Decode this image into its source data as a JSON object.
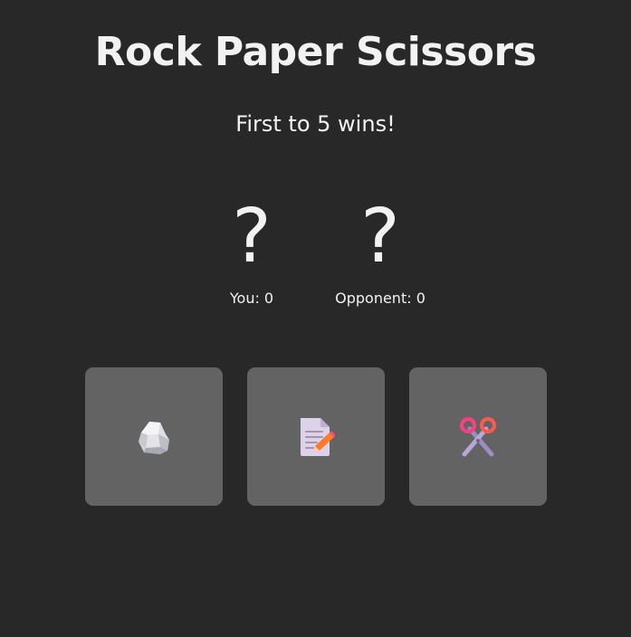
{
  "header": {
    "title": "Rock Paper Scissors",
    "subtitle": "First to 5 wins!"
  },
  "scoreboard": {
    "you": {
      "choice": "?",
      "label": "You: 0",
      "score": 0
    },
    "opponent": {
      "choice": "?",
      "label": "Opponent: 0",
      "score": 0
    }
  },
  "choices": [
    {
      "id": "rock",
      "icon": "rock-icon"
    },
    {
      "id": "paper",
      "icon": "paper-icon"
    },
    {
      "id": "scissors",
      "icon": "scissors-icon"
    }
  ],
  "colors": {
    "background": "#282828",
    "button": "#636363",
    "text": "#f2f2f2"
  }
}
